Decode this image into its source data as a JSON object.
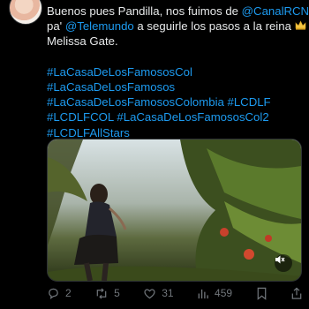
{
  "tweet": {
    "lines": [
      {
        "pre": "Buenos pues Pandilla, nos fuimos de ",
        "mention": "@CanalRCN"
      },
      {
        "pre": "pa' ",
        "mention": "@Telemundo",
        "post": " a seguirle los pasos a la reina"
      },
      {
        "pre": "Melissa Gate."
      }
    ],
    "hashtags": [
      "#LaCasaDeLosFamososCol",
      "#LaCasaDeLosFamosos",
      "#LaCasaDeLosFamososColombia #LCDLF",
      "#LCDLFCOL #LaCasaDeLosFamososCol2",
      "#LCDLFAllStars"
    ],
    "crown_icon": "crown-emoji"
  },
  "media": {
    "type": "video",
    "mute_icon": "speaker-muted-icon"
  },
  "actions": {
    "reply_count": "2",
    "retweet_count": "5",
    "like_count": "31",
    "view_count": "459"
  },
  "colors": {
    "background": "#000000",
    "text": "#e7e9ea",
    "link": "#1d9bf0",
    "muted": "#71767b"
  }
}
